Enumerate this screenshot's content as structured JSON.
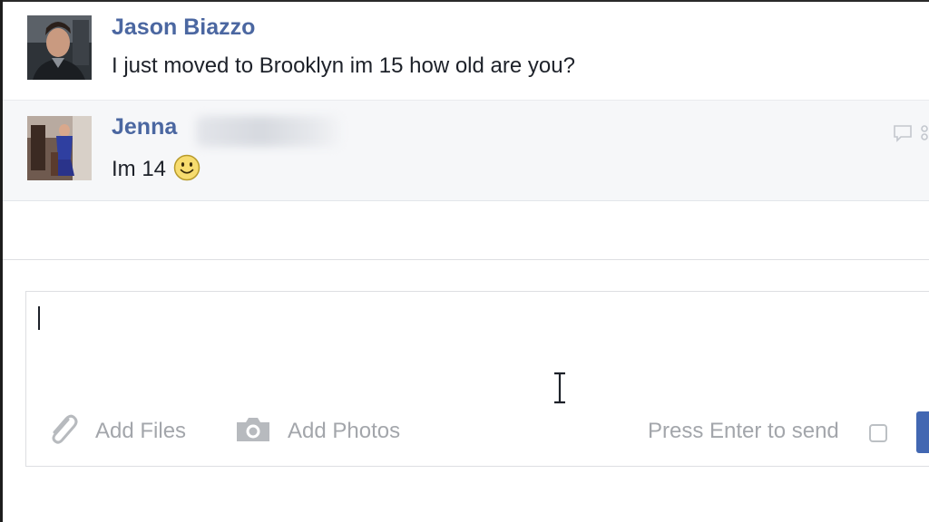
{
  "conversation": {
    "messages": [
      {
        "sender": "Jason Biazzo",
        "text": "I just moved to Brooklyn im 15 how old are you?",
        "avatar": "avatar-photo"
      },
      {
        "sender": "Jenna",
        "text": "Im 14",
        "emoji": "smiley-emoji",
        "avatar": "avatar-photo",
        "hover_icons": [
          "comment-icon",
          "more-icon"
        ]
      }
    ]
  },
  "composer": {
    "value": "",
    "add_files_label": "Add Files",
    "add_photos_label": "Add Photos",
    "press_enter_label": "Press Enter to send",
    "press_enter_checked": false
  },
  "colors": {
    "name_link": "#4b67a1",
    "message_text": "#1d2129",
    "muted_text": "#a3a6ab",
    "highlight_bg": "#f6f7f9",
    "send_button": "#4267b2"
  }
}
